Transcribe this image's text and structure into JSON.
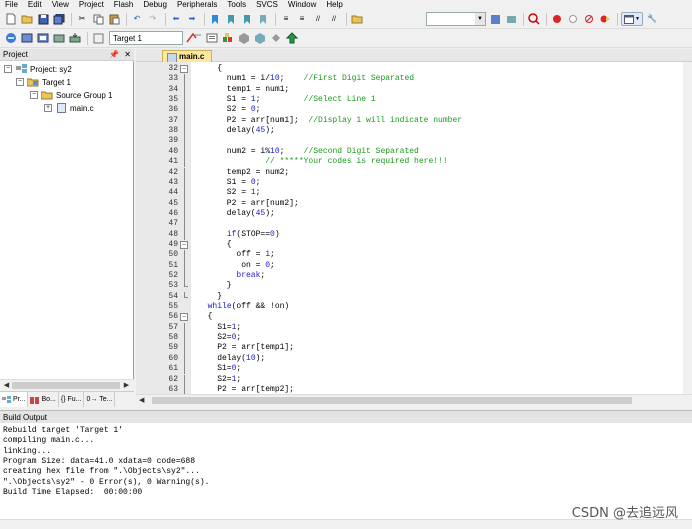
{
  "menu": [
    "File",
    "Edit",
    "View",
    "Project",
    "Flash",
    "Debug",
    "Peripherals",
    "Tools",
    "SVCS",
    "Window",
    "Help"
  ],
  "toolbar": {
    "target_select": "Target 1",
    "icons_row1": [
      "new-file-icon",
      "open-folder-icon",
      "save-icon",
      "save-all-icon",
      "cut-icon",
      "copy-icon",
      "paste-icon",
      "undo-icon",
      "redo-icon",
      "nav-back-icon",
      "nav-forward-icon",
      "bookmark-icon",
      "prev-bookmark-icon",
      "next-bookmark-icon",
      "clear-bookmarks-icon",
      "indent-icon",
      "unindent-icon",
      "comment-icon",
      "uncomment-icon",
      "find-in-files-icon"
    ],
    "icons_row2": [
      "translate-icon",
      "build-icon",
      "rebuild-icon",
      "batch-build-icon",
      "download-icon",
      "target-options-icon",
      "manage-components-icon",
      "file-extensions-icon",
      "pack-installer-icon",
      "select-packs-icon"
    ]
  },
  "project_panel": {
    "title": "Project",
    "tree": [
      {
        "label": "Project: sy2",
        "level": 0
      },
      {
        "label": "Target 1",
        "level": 1
      },
      {
        "label": "Source Group 1",
        "level": 2
      },
      {
        "label": "main.c",
        "level": 3
      }
    ],
    "tabs": [
      "Pr...",
      "Bo...",
      "{} Fu...",
      "0→ Te..."
    ]
  },
  "editor": {
    "file_tab": "main.c",
    "lines": [
      {
        "n": "32",
        "code": "    {",
        "fold": "box"
      },
      {
        "n": "33",
        "code": "      num1 = i/10;    //First Digit Separated",
        "fold": "line"
      },
      {
        "n": "34",
        "code": "      temp1 = num1;",
        "fold": "line"
      },
      {
        "n": "35",
        "code": "      S1 = 1;         //Select Line 1",
        "fold": "line"
      },
      {
        "n": "36",
        "code": "      S2 = 0;",
        "fold": "line"
      },
      {
        "n": "37",
        "code": "      P2 = arr[num1];  //Display 1 will indicate number",
        "fold": "line"
      },
      {
        "n": "38",
        "code": "      delay(45);",
        "fold": "line"
      },
      {
        "n": "39",
        "code": "",
        "fold": "line"
      },
      {
        "n": "40",
        "code": "      num2 = i%10;    //Second Digit Separated",
        "fold": "line"
      },
      {
        "n": "41",
        "code": "              // *****Your codes is required here!!!",
        "fold": "line"
      },
      {
        "n": "42",
        "code": "      temp2 = num2;",
        "fold": "line"
      },
      {
        "n": "43",
        "code": "      S1 = 0;",
        "fold": "line"
      },
      {
        "n": "44",
        "code": "      S2 = 1;",
        "fold": "line"
      },
      {
        "n": "45",
        "code": "      P2 = arr[num2];",
        "fold": "line"
      },
      {
        "n": "46",
        "code": "      delay(45);",
        "fold": "line"
      },
      {
        "n": "47",
        "code": "",
        "fold": "line"
      },
      {
        "n": "48",
        "code": "      if(STOP==0)",
        "fold": "line"
      },
      {
        "n": "49",
        "code": "      {",
        "fold": "box"
      },
      {
        "n": "50",
        "code": "        off = 1;",
        "fold": "line"
      },
      {
        "n": "51",
        "code": "         on = 0;",
        "fold": "line"
      },
      {
        "n": "52",
        "code": "        break;",
        "fold": "line"
      },
      {
        "n": "53",
        "code": "      }",
        "fold": "end"
      },
      {
        "n": "54",
        "code": "    }",
        "fold": "end"
      },
      {
        "n": "55",
        "code": "  while(off && !on)",
        "fold": "none"
      },
      {
        "n": "56",
        "code": "  {",
        "fold": "box"
      },
      {
        "n": "57",
        "code": "    S1=1;",
        "fold": "line"
      },
      {
        "n": "58",
        "code": "    S2=0;",
        "fold": "line"
      },
      {
        "n": "59",
        "code": "    P2 = arr[temp1];",
        "fold": "line"
      },
      {
        "n": "60",
        "code": "    delay(10);",
        "fold": "line"
      },
      {
        "n": "61",
        "code": "    S1=0;",
        "fold": "line"
      },
      {
        "n": "62",
        "code": "    S2=1;",
        "fold": "line"
      },
      {
        "n": "63",
        "code": "    P2 = arr[temp2];",
        "fold": "line"
      }
    ]
  },
  "build_output": {
    "title": "Build Output",
    "lines": [
      "Rebuild target 'Target 1'",
      "compiling main.c...",
      "linking...",
      "Program Size: data=41.0 xdata=0 code=688",
      "creating hex file from \".\\Objects\\sy2\"...",
      "\".\\Objects\\sy2\" - 0 Error(s), 0 Warning(s).",
      "Build Time Elapsed:  00:00:00"
    ]
  },
  "watermark": "CSDN @去追远风",
  "colors": {
    "comment": "#1a9a1a",
    "number": "#1a1acc",
    "file_tab": "#ffe79b",
    "gutter": "#e9e9e9"
  }
}
